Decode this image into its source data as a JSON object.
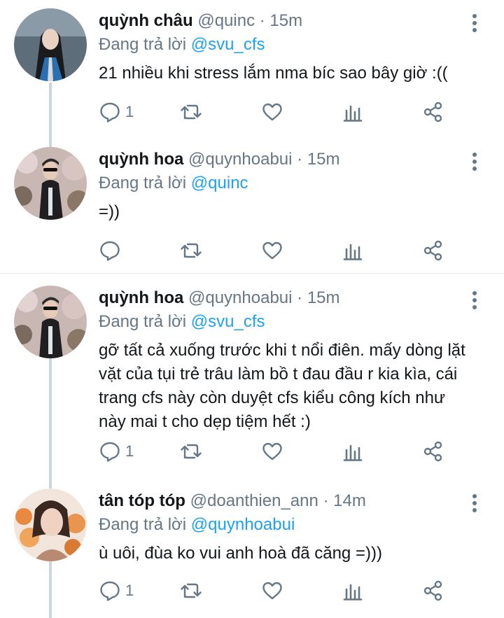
{
  "tweets": [
    {
      "name": "quỳnh châu",
      "handle": "@quinc",
      "time": "· 15m",
      "reply_prefix": "Đang trả lời ",
      "reply_to": "@svu_cfs",
      "text": "21 nhiều khi stress lắm nma bíc sao bây giờ :((",
      "reply_count": "1",
      "avatar_icon": "avatar-photo"
    },
    {
      "name": "quỳnh hoa",
      "handle": "@quynhoabui",
      "time": "· 15m",
      "reply_prefix": "Đang trả lời ",
      "reply_to": "@quinc",
      "text": "=))",
      "reply_count": "",
      "avatar_icon": "avatar-photo"
    },
    {
      "name": "quỳnh hoa",
      "handle": "@quynhoabui",
      "time": "· 15m",
      "reply_prefix": "Đang trả lời ",
      "reply_to": "@svu_cfs",
      "text": "gỡ tất cả xuống trước khi t nổi điên. mấy dòng lặt vặt của tụi trẻ trâu làm bồ t đau đầu r kia kìa, cái trang cfs này còn duyệt cfs kiểu công kích như này mai t cho dẹp tiệm hết :)",
      "reply_count": "1",
      "avatar_icon": "avatar-photo"
    },
    {
      "name": "tân tóp tóp",
      "handle": "@doanthien_ann",
      "time": "· 14m",
      "reply_prefix": "Đang trả lời ",
      "reply_to": "@quynhoabui",
      "text": "ù uôi, đùa ko vui anh hoà đã căng =)))",
      "reply_count": "1",
      "avatar_icon": "avatar-photo"
    }
  ],
  "icons": {
    "reply": "reply-icon",
    "retweet": "retweet-icon",
    "like": "like-icon",
    "analytics": "analytics-icon",
    "share": "share-icon",
    "more": "more-icon"
  },
  "colors": {
    "accent": "#1da1f2",
    "secondary_text": "#657786",
    "thread_line": "#ccd6dd"
  }
}
